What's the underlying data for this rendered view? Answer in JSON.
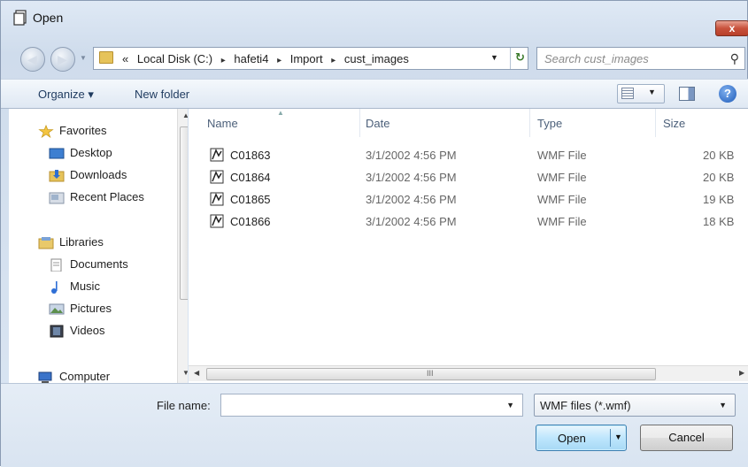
{
  "window": {
    "title": "Open",
    "close_label": "x"
  },
  "address": {
    "segments": [
      "«",
      "Local Disk (C:)",
      "hafeti4",
      "Import",
      "cust_images"
    ],
    "separator": "▸"
  },
  "search": {
    "placeholder": "Search cust_images"
  },
  "toolbar": {
    "organize": "Organize ▾",
    "new_folder": "New folder",
    "help": "?"
  },
  "nav": {
    "favorites": "Favorites",
    "desktop": "Desktop",
    "downloads": "Downloads",
    "recent": "Recent Places",
    "libraries": "Libraries",
    "documents": "Documents",
    "music": "Music",
    "pictures": "Pictures",
    "videos": "Videos",
    "computer": "Computer"
  },
  "columns": {
    "name": "Name",
    "date": "Date",
    "type": "Type",
    "size": "Size"
  },
  "files": [
    {
      "name": "C01863",
      "date": "3/1/2002 4:56 PM",
      "type": "WMF File",
      "size": "20 KB"
    },
    {
      "name": "C01864",
      "date": "3/1/2002 4:56 PM",
      "type": "WMF File",
      "size": "20 KB"
    },
    {
      "name": "C01865",
      "date": "3/1/2002 4:56 PM",
      "type": "WMF File",
      "size": "19 KB"
    },
    {
      "name": "C01866",
      "date": "3/1/2002 4:56 PM",
      "type": "WMF File",
      "size": "18 KB"
    }
  ],
  "bottom": {
    "filename_label": "File name:",
    "filename_value": "",
    "filter": "WMF files (*.wmf)",
    "open": "Open",
    "cancel": "Cancel"
  },
  "scroll_grip": "III"
}
